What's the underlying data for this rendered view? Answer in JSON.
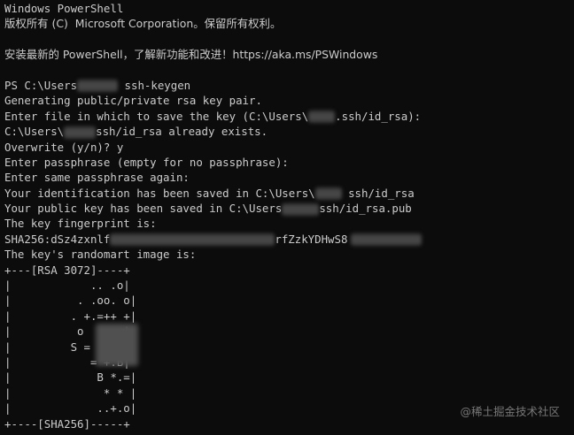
{
  "window": {
    "header_title": "Windows PowerShell",
    "copyright": "版权所有 (C)  Microsoft Corporation。保留所有权利。",
    "install_hint": "安装最新的 PowerShell，了解新功能和改进！https://aka.ms/PSWindows"
  },
  "session": {
    "prompt_prefix": "PS C:\\Users",
    "command": " ssh-keygen",
    "generating": "Generating public/private rsa key pair.",
    "enter_file_prefix": "Enter file in which to save the key (C:\\Users\\",
    "enter_file_suffix": ".ssh/id_rsa):",
    "exists_prefix": "C:\\Users\\",
    "exists_suffix": "ssh/id_rsa already exists.",
    "overwrite": "Overwrite (y/n)? y",
    "passphrase": "Enter passphrase (empty for no passphrase):",
    "passphrase_again": "Enter same passphrase again:",
    "identification_prefix": "Your identification has been saved in C:\\Users\\",
    "identification_suffix": " ssh/id_rsa",
    "public_key_prefix": "Your public key has been saved in C:\\Users",
    "public_key_suffix": "ssh/id_rsa.pub",
    "fingerprint_label": "The key fingerprint is:",
    "fingerprint_prefix": "SHA256:dSz4zxnlf",
    "fingerprint_middle": "rfZzkYDHwS8",
    "randomart_label": "The key's randomart image is:"
  },
  "randomart": [
    "+---[RSA 3072]----+",
    "|            .. .o|",
    "|          . .oo. o|",
    "|         . +.=++ +|",
    "|          o      |",
    "|         S =     |",
    "|            = +.B|",
    "|             B *.=|",
    "|              * * |",
    "|             ..+.o|",
    "+----[SHA256]-----+"
  ],
  "watermark": "@稀土掘金技术社区"
}
